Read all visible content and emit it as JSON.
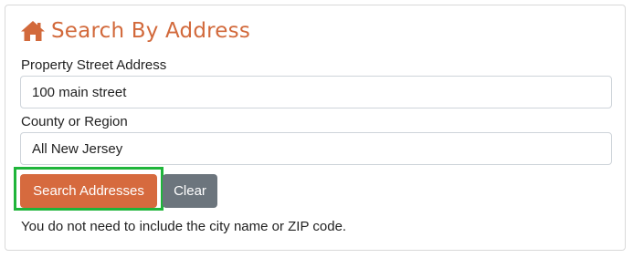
{
  "form": {
    "title": "Search By Address",
    "title_icon": "home-icon",
    "address_label": "Property Street Address",
    "address_value": "100 main street",
    "county_label": "County or Region",
    "county_value": "All New Jersey",
    "search_button": "Search Addresses",
    "clear_button": "Clear",
    "help_text": "You do not need to include the city name or ZIP code."
  },
  "colors": {
    "accent": "#d66a3e",
    "secondary": "#6c757d",
    "focus": "#1fb53a"
  }
}
